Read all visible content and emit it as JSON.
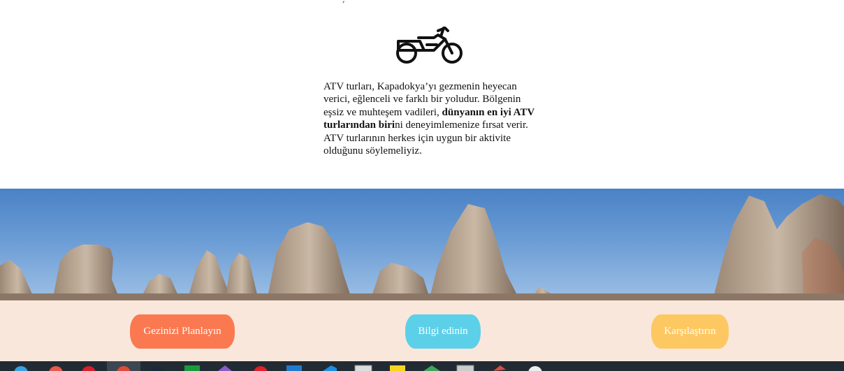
{
  "intro": {
    "text_before": "ATV turları, Kapadokya’yı gezmenin heyecan verici, eğlenceli ve farklı bir yoludur. Bölgenin eşsiz ve muhteşem vadileri, ",
    "text_bold": "dünyanın en iyi ATV turlarından biri",
    "text_after": "ni deneyimlemenize fırsat verir. ATV turlarının herkes için uygun bir aktivite olduğunu söylemeliyiz."
  },
  "icons": {
    "feature": "motorcycle-icon"
  },
  "cta": {
    "plan_label": "Gezinizi Planlayın",
    "info_label": "Bilgi edinin",
    "compare_label": "Karşılaştırın"
  },
  "colors": {
    "plan": "#fb7950",
    "info": "#5dd0e9",
    "compare": "#fdc862",
    "band": "#f9e7dc",
    "taskbar": "#222b33"
  },
  "taskbar": {
    "icons": [
      "browser-icon",
      "google-icon",
      "opera-icon",
      "chrome-icon",
      "steam-icon",
      "xbox-icon",
      "app-icon",
      "youtube-icon",
      "terminal-icon",
      "vscode-icon",
      "monitor-icon",
      "notes-icon",
      "maps-icon",
      "window-icon",
      "pencil-icon",
      "clock-icon"
    ]
  }
}
